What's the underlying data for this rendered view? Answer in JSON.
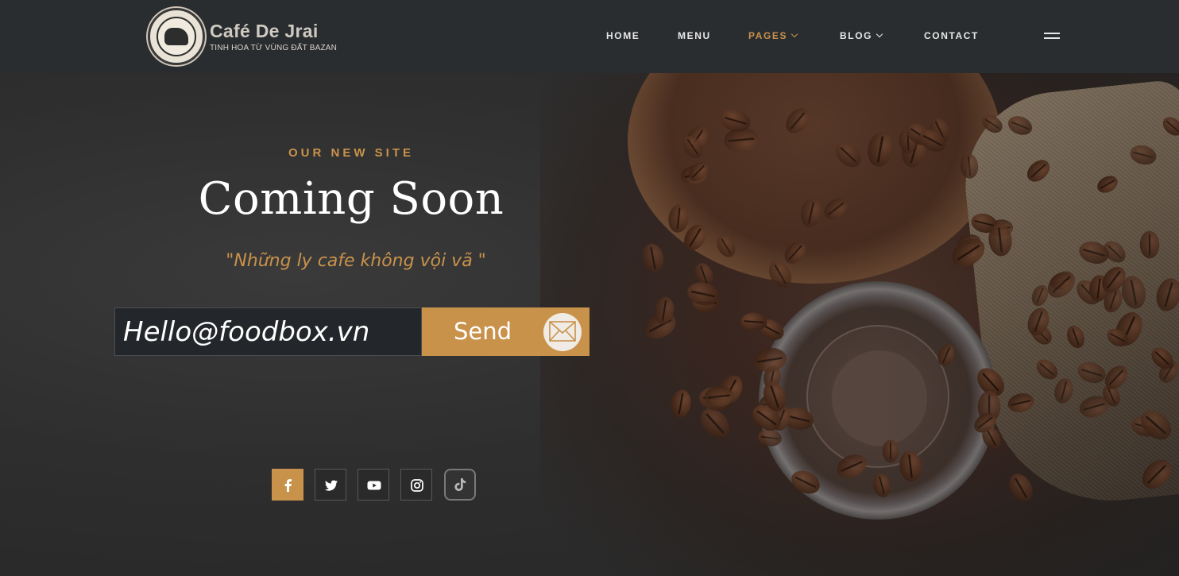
{
  "brand": {
    "name": "Café De Jrai",
    "tagline": "TINH HOA TỪ VÙNG ĐẤT BAZAN",
    "logo_icon": "elephant-badge-logo"
  },
  "nav": {
    "items": [
      {
        "label": "HOME",
        "has_dropdown": false
      },
      {
        "label": "MENU",
        "has_dropdown": false
      },
      {
        "label": "PAGES",
        "has_dropdown": true,
        "active": true
      },
      {
        "label": "BLOG",
        "has_dropdown": true
      },
      {
        "label": "CONTACT",
        "has_dropdown": false
      }
    ],
    "menu_icon": "hamburger-icon"
  },
  "hero": {
    "eyebrow": "OUR NEW SITE",
    "headline": "Coming Soon",
    "quote": "\"Những ly cafe không vội vã \""
  },
  "subscribe": {
    "email_placeholder": "Hello@foodbox.vn",
    "send_label": "Send",
    "send_icon": "envelope-icon"
  },
  "social": [
    {
      "name": "facebook-icon",
      "active": true
    },
    {
      "name": "twitter-icon",
      "active": false
    },
    {
      "name": "youtube-icon",
      "active": false
    },
    {
      "name": "instagram-icon",
      "active": false
    },
    {
      "name": "tiktok-icon",
      "active": false
    }
  ],
  "colors": {
    "accent": "#c9924b",
    "header_bg": "#2a2d30",
    "input_bg": "#23262a",
    "text_light": "#ffffff"
  }
}
